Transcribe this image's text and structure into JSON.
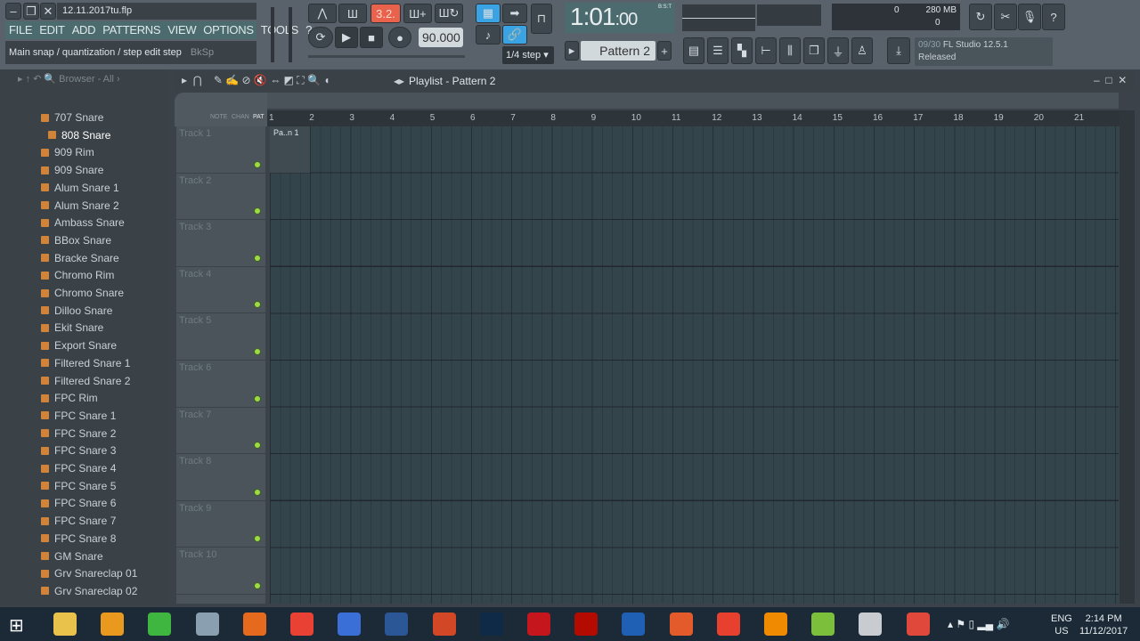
{
  "window": {
    "title": "12.11.2017tu.flp"
  },
  "menu": [
    "FILE",
    "EDIT",
    "ADD",
    "PATTERNS",
    "VIEW",
    "OPTIONS",
    "TOOLS",
    "?"
  ],
  "hint": {
    "text": "Main snap / quantization / step edit step",
    "key": "BkSp"
  },
  "transport": {
    "pattern_mode_label": "3.2.",
    "tempo": "90.000",
    "time_main": "1:01",
    "time_sub": ":00",
    "time_format": "B:S:T"
  },
  "snap": {
    "value": "1/4 step"
  },
  "pattern": {
    "name": "Pattern 2"
  },
  "cpu": {
    "cpu": "0",
    "memory": "280 MB",
    "poly": "0"
  },
  "news": {
    "count": "09/30",
    "title": "FL Studio 12.5.1",
    "status": "Released"
  },
  "browser": {
    "title": "Browser - All",
    "items": [
      "707 Snare",
      "808 Snare",
      "909 Rim",
      "909 Snare",
      "Alum Snare 1",
      "Alum Snare 2",
      "Ambass Snare",
      "BBox Snare",
      "Bracke Snare",
      "Chromo Rim",
      "Chromo Snare",
      "Dilloo Snare",
      "Ekit Snare",
      "Export Snare",
      "Filtered Snare 1",
      "Filtered Snare 2",
      "FPC Rim",
      "FPC Snare 1",
      "FPC Snare 2",
      "FPC Snare 3",
      "FPC Snare 4",
      "FPC Snare 5",
      "FPC Snare 6",
      "FPC Snare 7",
      "FPC Snare 8",
      "GM Snare",
      "Grv Snareclap 01",
      "Grv Snareclap 02"
    ],
    "selected": "808 Snare"
  },
  "playlist": {
    "title": "Playlist - Pattern 2",
    "tabs": [
      "NOTE",
      "CHAN",
      "PAT"
    ],
    "clip": "Pa..n 1",
    "bars": [
      "1",
      "2",
      "3",
      "4",
      "5",
      "6",
      "7",
      "8",
      "9",
      "10",
      "11",
      "12",
      "13",
      "14",
      "15",
      "16",
      "17",
      "18",
      "19",
      "20",
      "21"
    ],
    "tracks": [
      "Track 1",
      "Track 2",
      "Track 3",
      "Track 4",
      "Track 5",
      "Track 6",
      "Track 7",
      "Track 8",
      "Track 9",
      "Track 10"
    ]
  },
  "taskbar": {
    "apps": [
      "file-explorer",
      "fl-studio",
      "camtasia",
      "app",
      "firefox",
      "chrome",
      "3d-app",
      "word",
      "powerpoint",
      "photoshop",
      "acrobat",
      "acrobat-dc",
      "media-app",
      "ccleaner",
      "app-red",
      "vlc",
      "bluestacks",
      "app-globe",
      "camtasia-recorder"
    ],
    "lang": "ENG",
    "region": "US",
    "time": "2:14 PM",
    "date": "11/12/2017"
  },
  "colors": {
    "accent": "#9bdc43",
    "pattern_mode": "#e8624c",
    "selected_tool": "#3aa3e3"
  }
}
